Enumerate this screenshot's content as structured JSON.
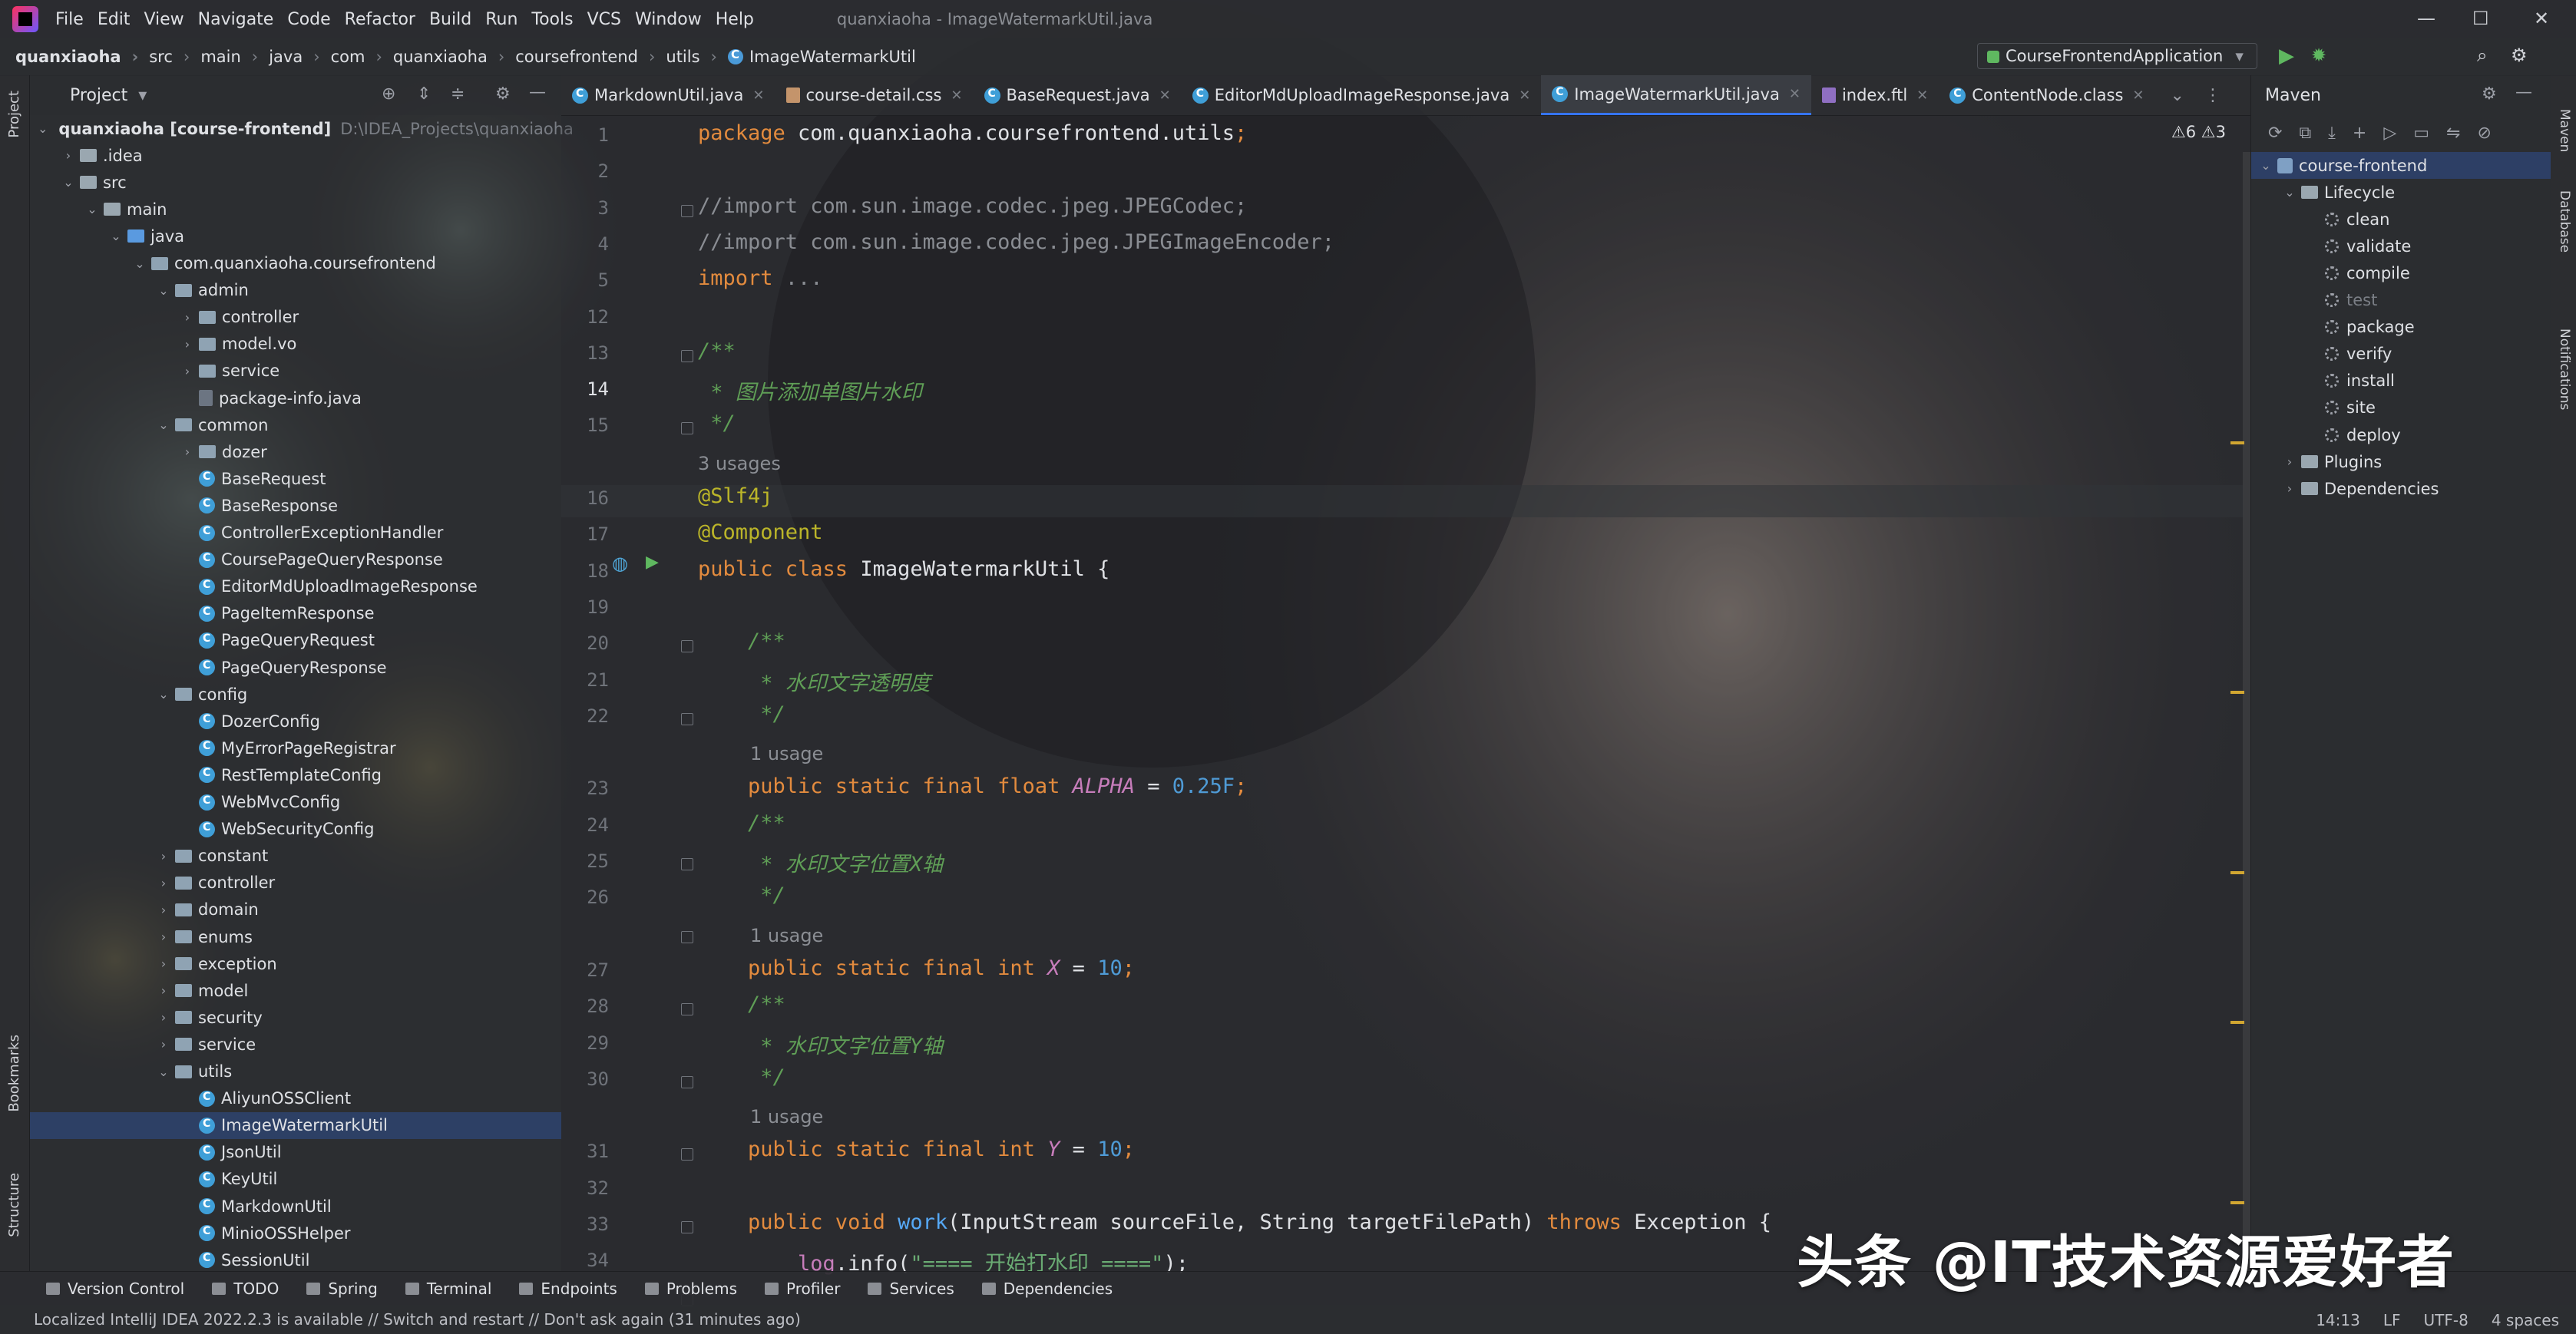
{
  "menubar": {
    "items": [
      "File",
      "Edit",
      "View",
      "Navigate",
      "Code",
      "Refactor",
      "Build",
      "Run",
      "Tools",
      "VCS",
      "Window",
      "Help"
    ],
    "window_title": "quanxiaoha - ImageWatermarkUtil.java"
  },
  "navbar": {
    "breadcrumbs": [
      "quanxiaoha",
      "src",
      "main",
      "java",
      "com",
      "quanxiaoha",
      "coursefrontend",
      "utils",
      "ImageWatermarkUtil"
    ],
    "run_config": "CourseFrontendApplication"
  },
  "left_stripe": {
    "top_label": "Project",
    "bookmarks": "Bookmarks",
    "structure": "Structure"
  },
  "project": {
    "title": "Project",
    "tree": [
      {
        "depth": 0,
        "arrow": "open",
        "icon": "module",
        "label": "quanxiaoha [course-frontend]",
        "extra": "D:\\IDEA_Projects\\quanxiaoha"
      },
      {
        "depth": 1,
        "arrow": "closed",
        "icon": "folder",
        "label": ".idea"
      },
      {
        "depth": 1,
        "arrow": "open",
        "icon": "folder",
        "label": "src"
      },
      {
        "depth": 2,
        "arrow": "open",
        "icon": "folder",
        "label": "main"
      },
      {
        "depth": 3,
        "arrow": "open",
        "icon": "folder-blue",
        "label": "java"
      },
      {
        "depth": 4,
        "arrow": "open",
        "icon": "pkg",
        "label": "com.quanxiaoha.coursefrontend"
      },
      {
        "depth": 5,
        "arrow": "open",
        "icon": "pkg",
        "label": "admin"
      },
      {
        "depth": 6,
        "arrow": "closed",
        "icon": "pkg",
        "label": "controller"
      },
      {
        "depth": 6,
        "arrow": "closed",
        "icon": "pkg",
        "label": "model.vo"
      },
      {
        "depth": 6,
        "arrow": "closed",
        "icon": "pkg",
        "label": "service"
      },
      {
        "depth": 6,
        "arrow": "none",
        "icon": "file",
        "label": "package-info.java"
      },
      {
        "depth": 5,
        "arrow": "open",
        "icon": "pkg",
        "label": "common"
      },
      {
        "depth": 6,
        "arrow": "closed",
        "icon": "pkg",
        "label": "dozer"
      },
      {
        "depth": 6,
        "arrow": "none",
        "icon": "class",
        "label": "BaseRequest"
      },
      {
        "depth": 6,
        "arrow": "none",
        "icon": "class",
        "label": "BaseResponse"
      },
      {
        "depth": 6,
        "arrow": "none",
        "icon": "class",
        "label": "ControllerExceptionHandler"
      },
      {
        "depth": 6,
        "arrow": "none",
        "icon": "class",
        "label": "CoursePageQueryResponse"
      },
      {
        "depth": 6,
        "arrow": "none",
        "icon": "class",
        "label": "EditorMdUploadImageResponse"
      },
      {
        "depth": 6,
        "arrow": "none",
        "icon": "class",
        "label": "PageItemResponse"
      },
      {
        "depth": 6,
        "arrow": "none",
        "icon": "class",
        "label": "PageQueryRequest"
      },
      {
        "depth": 6,
        "arrow": "none",
        "icon": "class",
        "label": "PageQueryResponse"
      },
      {
        "depth": 5,
        "arrow": "open",
        "icon": "pkg",
        "label": "config"
      },
      {
        "depth": 6,
        "arrow": "none",
        "icon": "class",
        "label": "DozerConfig"
      },
      {
        "depth": 6,
        "arrow": "none",
        "icon": "class",
        "label": "MyErrorPageRegistrar"
      },
      {
        "depth": 6,
        "arrow": "none",
        "icon": "class",
        "label": "RestTemplateConfig"
      },
      {
        "depth": 6,
        "arrow": "none",
        "icon": "class",
        "label": "WebMvcConfig"
      },
      {
        "depth": 6,
        "arrow": "none",
        "icon": "class",
        "label": "WebSecurityConfig"
      },
      {
        "depth": 5,
        "arrow": "closed",
        "icon": "pkg",
        "label": "constant"
      },
      {
        "depth": 5,
        "arrow": "closed",
        "icon": "pkg",
        "label": "controller"
      },
      {
        "depth": 5,
        "arrow": "closed",
        "icon": "pkg",
        "label": "domain"
      },
      {
        "depth": 5,
        "arrow": "closed",
        "icon": "pkg",
        "label": "enums"
      },
      {
        "depth": 5,
        "arrow": "closed",
        "icon": "pkg",
        "label": "exception"
      },
      {
        "depth": 5,
        "arrow": "closed",
        "icon": "pkg",
        "label": "model"
      },
      {
        "depth": 5,
        "arrow": "closed",
        "icon": "pkg",
        "label": "security"
      },
      {
        "depth": 5,
        "arrow": "closed",
        "icon": "pkg",
        "label": "service"
      },
      {
        "depth": 5,
        "arrow": "open",
        "icon": "pkg",
        "label": "utils"
      },
      {
        "depth": 6,
        "arrow": "none",
        "icon": "class",
        "label": "AliyunOSSClient"
      },
      {
        "depth": 6,
        "arrow": "none",
        "icon": "class",
        "label": "ImageWatermarkUtil",
        "selected": true
      },
      {
        "depth": 6,
        "arrow": "none",
        "icon": "class",
        "label": "JsonUtil"
      },
      {
        "depth": 6,
        "arrow": "none",
        "icon": "class",
        "label": "KeyUtil"
      },
      {
        "depth": 6,
        "arrow": "none",
        "icon": "class",
        "label": "MarkdownUtil"
      },
      {
        "depth": 6,
        "arrow": "none",
        "icon": "class",
        "label": "MinioOSSHelper"
      },
      {
        "depth": 6,
        "arrow": "none",
        "icon": "class",
        "label": "SessionUtil"
      }
    ]
  },
  "tabs": [
    {
      "label": "MarkdownUtil.java",
      "icon": "class",
      "active": false
    },
    {
      "label": "course-detail.css",
      "icon": "css",
      "active": false
    },
    {
      "label": "BaseRequest.java",
      "icon": "class",
      "active": false
    },
    {
      "label": "EditorMdUploadImageResponse.java",
      "icon": "class",
      "active": false
    },
    {
      "label": "ImageWatermarkUtil.java",
      "icon": "class",
      "active": true
    },
    {
      "label": "index.ftl",
      "icon": "ftl",
      "active": false
    },
    {
      "label": "ContentNode.class",
      "icon": "class",
      "active": false
    }
  ],
  "editor": {
    "warnings": "⚠6  ⚠3",
    "lines": [
      {
        "n": "1",
        "t": "package",
        "parts": [
          [
            "kw",
            "package "
          ],
          [
            "",
            "com.quanxiaoha.coursefrontend.utils"
          ],
          [
            "kw",
            ";"
          ]
        ]
      },
      {
        "n": "2",
        "parts": []
      },
      {
        "n": "3",
        "parts": [
          [
            "cmt",
            "//import com.sun.image.codec.jpeg.JPEGCodec;"
          ]
        ]
      },
      {
        "n": "4",
        "parts": [
          [
            "cmt",
            "//import com.sun.image.codec.jpeg.JPEGImageEncoder;"
          ]
        ]
      },
      {
        "n": "5",
        "parts": [
          [
            "kw",
            "import "
          ],
          [
            "cmt",
            "..."
          ]
        ]
      },
      {
        "n": "12",
        "parts": []
      },
      {
        "n": "13",
        "parts": [
          [
            "doc",
            "/**"
          ]
        ]
      },
      {
        "n": "14",
        "parts": [
          [
            "doc",
            " * 图片添加单图片水印"
          ]
        ]
      },
      {
        "n": "15",
        "parts": [
          [
            "doc",
            " */"
          ]
        ]
      },
      {
        "usage": "3 usages"
      },
      {
        "n": "16",
        "parts": [
          [
            "ann",
            "@Slf4j"
          ]
        ]
      },
      {
        "n": "17",
        "parts": [
          [
            "ann",
            "@Component"
          ]
        ]
      },
      {
        "n": "18",
        "parts": [
          [
            "kw",
            "public class "
          ],
          [
            "",
            "ImageWatermarkUtil {"
          ]
        ]
      },
      {
        "n": "19",
        "parts": []
      },
      {
        "n": "20",
        "parts": [
          [
            "doc",
            "    /**"
          ]
        ]
      },
      {
        "n": "21",
        "parts": [
          [
            "doc",
            "     * 水印文字透明度"
          ]
        ]
      },
      {
        "n": "22",
        "parts": [
          [
            "doc",
            "     */"
          ]
        ]
      },
      {
        "usage": "1 usage"
      },
      {
        "n": "23",
        "parts": [
          [
            "kw",
            "    public static final float "
          ],
          [
            "konst",
            "ALPHA"
          ],
          [
            "",
            " = "
          ],
          [
            "num",
            "0.25F"
          ],
          [
            "kw",
            ";"
          ]
        ]
      },
      {
        "n": "24",
        "parts": [
          [
            "doc",
            "    /**"
          ]
        ]
      },
      {
        "n": "25",
        "parts": [
          [
            "doc",
            "     * 水印文字位置X轴"
          ]
        ]
      },
      {
        "n": "26",
        "parts": [
          [
            "doc",
            "     */"
          ]
        ]
      },
      {
        "usage": "1 usage"
      },
      {
        "n": "27",
        "parts": [
          [
            "kw",
            "    public static final int "
          ],
          [
            "konst",
            "X"
          ],
          [
            "",
            " = "
          ],
          [
            "num",
            "10"
          ],
          [
            "kw",
            ";"
          ]
        ]
      },
      {
        "n": "28",
        "parts": [
          [
            "doc",
            "    /**"
          ]
        ]
      },
      {
        "n": "29",
        "parts": [
          [
            "doc",
            "     * 水印文字位置Y轴"
          ]
        ]
      },
      {
        "n": "30",
        "parts": [
          [
            "doc",
            "     */"
          ]
        ]
      },
      {
        "usage": "1 usage"
      },
      {
        "n": "31",
        "parts": [
          [
            "kw",
            "    public static final int "
          ],
          [
            "konst",
            "Y"
          ],
          [
            "",
            " = "
          ],
          [
            "num",
            "10"
          ],
          [
            "kw",
            ";"
          ]
        ]
      },
      {
        "n": "32",
        "parts": []
      },
      {
        "n": "33",
        "parts": [
          [
            "kw",
            "    public void "
          ],
          [
            "fn",
            "work"
          ],
          [
            "",
            "(InputStream sourceFile, String targetFilePath) "
          ],
          [
            "kw",
            "throws "
          ],
          [
            "",
            "Exception {"
          ]
        ]
      },
      {
        "n": "34",
        "parts": [
          [
            "field",
            "        log"
          ],
          [
            "",
            ".info("
          ],
          [
            "str",
            "\"==== 开始打水印 ====\""
          ],
          [
            "",
            ");"
          ]
        ]
      }
    ]
  },
  "maven": {
    "title": "Maven",
    "rows": [
      {
        "depth": 0,
        "arrow": "open",
        "icon": "mvn",
        "label": "course-frontend",
        "selected": true
      },
      {
        "depth": 1,
        "arrow": "open",
        "icon": "folder",
        "label": "Lifecycle"
      },
      {
        "depth": 2,
        "icon": "gear",
        "label": "clean"
      },
      {
        "depth": 2,
        "icon": "gear",
        "label": "validate"
      },
      {
        "depth": 2,
        "icon": "gear",
        "label": "compile"
      },
      {
        "depth": 2,
        "icon": "gear",
        "label": "test",
        "muted": true
      },
      {
        "depth": 2,
        "icon": "gear",
        "label": "package"
      },
      {
        "depth": 2,
        "icon": "gear",
        "label": "verify"
      },
      {
        "depth": 2,
        "icon": "gear",
        "label": "install"
      },
      {
        "depth": 2,
        "icon": "gear",
        "label": "site"
      },
      {
        "depth": 2,
        "icon": "gear",
        "label": "deploy"
      },
      {
        "depth": 1,
        "arrow": "closed",
        "icon": "folder",
        "label": "Plugins"
      },
      {
        "depth": 1,
        "arrow": "closed",
        "icon": "folder",
        "label": "Dependencies"
      }
    ]
  },
  "right_stripe": {
    "maven": "Maven",
    "database": "Database",
    "notifications": "Notifications"
  },
  "toolwindows": [
    "Version Control",
    "TODO",
    "Spring",
    "Terminal",
    "Endpoints",
    "Problems",
    "Profiler",
    "Services",
    "Dependencies"
  ],
  "status": {
    "message": "Localized IntelliJ IDEA 2022.2.3 is available // Switch and restart // Don't ask again (31 minutes ago)",
    "time": "14:13",
    "line_sep": "LF",
    "encoding": "UTF-8",
    "indent": "4 spaces"
  },
  "watermark": "头条 @IT技术资源爱好者",
  "colors": {
    "accent": "#3574f0",
    "keyword": "#e38b3e",
    "doc": "#5f9e56",
    "annotation": "#bbb529"
  }
}
